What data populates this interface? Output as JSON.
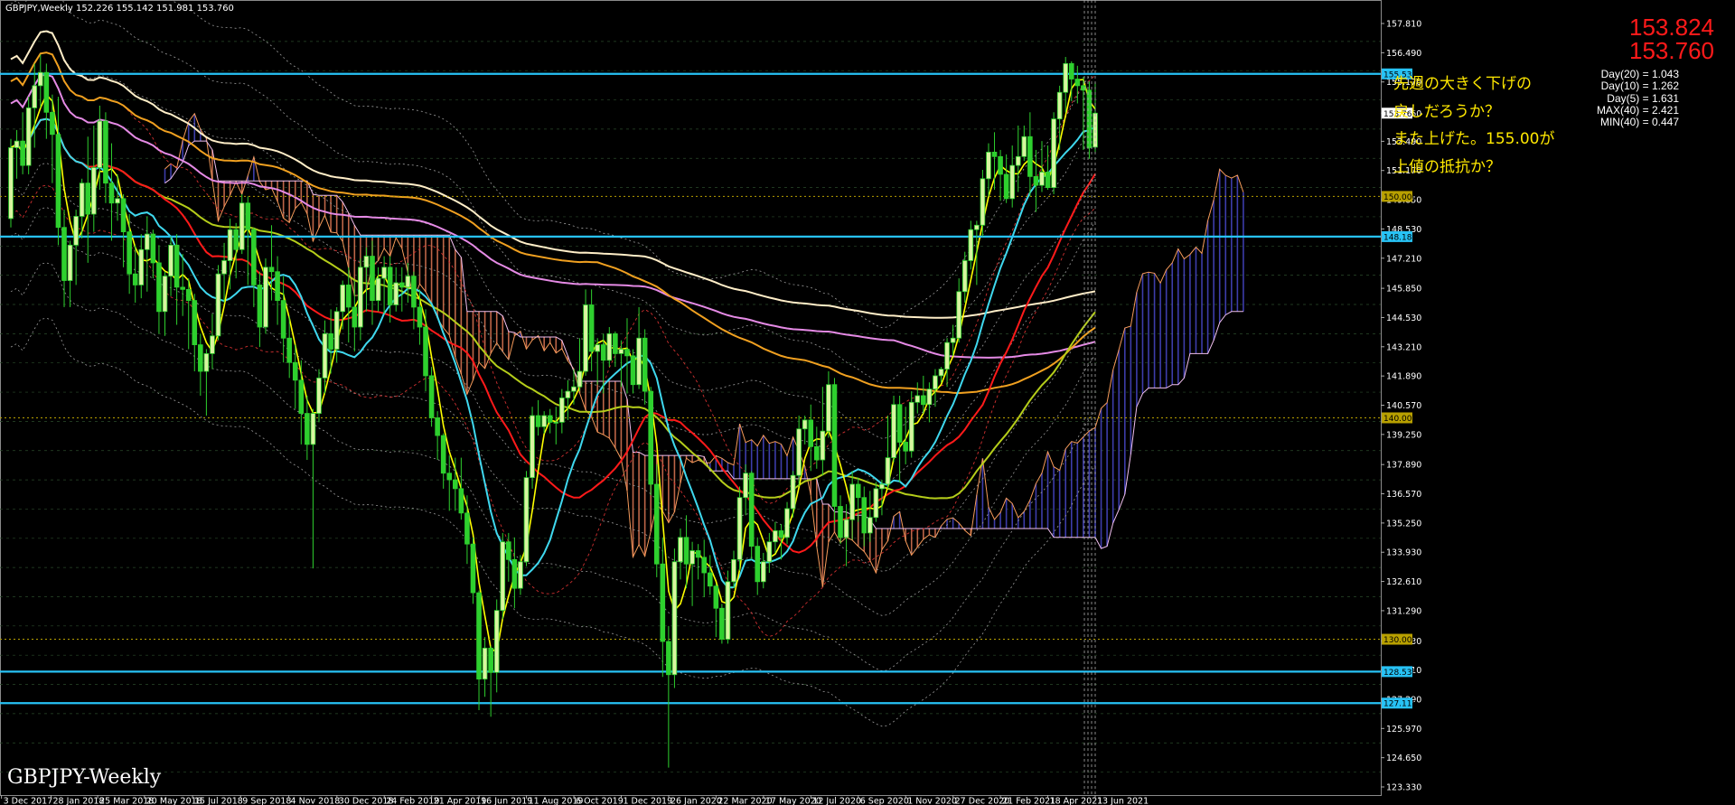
{
  "header": {
    "symbol": "GBPJPY,Weekly",
    "ohlc": "152.226 155.142 151.981 153.760"
  },
  "watermark": "GBPJPY-Weekly",
  "big_prices": {
    "bid": "153.824",
    "last": "153.760"
  },
  "stats": [
    "Day(20) = 1.043",
    "Day(10) = 1.262",
    "Day(5) = 1.631",
    "MAX(40) = 2.421",
    "MIN(40) = 0.447"
  ],
  "note_lines": [
    "先週の大きく下げの",
    "戻しだろうか？",
    "また上げた。155.00が",
    "上値の抵抗か？"
  ],
  "colors": {
    "background": "#000000",
    "bull": "#d8f5a0",
    "bear": "#2ed02e",
    "hline": "#27c2f5",
    "price_tag": "#27c2f5",
    "level_tag": "#b8a000",
    "ma_fast": "#ffff00",
    "ma_cyan": "#3fd8ee",
    "ma_red": "#ff1a1a",
    "ma_olive": "#b5cd1a",
    "ma_orange": "#f0a020",
    "ma_pink": "#e58ae5",
    "ma_cream": "#ffeec8",
    "cloud_up": "#4848c8",
    "cloud_down": "#e07855"
  },
  "chart_data": {
    "type": "candlestick",
    "title": "GBPJPY,Weekly",
    "ylim": [
      123.33,
      158.3
    ],
    "y_ticks": [
      "157.810",
      "156.490",
      "155.170",
      "153.760",
      "152.490",
      "151.170",
      "149.850",
      "148.530",
      "147.210",
      "145.850",
      "144.530",
      "143.210",
      "141.890",
      "140.570",
      "139.250",
      "137.890",
      "136.570",
      "135.250",
      "133.930",
      "132.610",
      "131.290",
      "129.930",
      "128.610",
      "127.290",
      "125.970",
      "124.650",
      "123.330"
    ],
    "x_ticks": [
      "3 Dec 2017",
      "28 Jan 2018",
      "25 Mar 2018",
      "20 May 2018",
      "15 Jul 2018",
      "9 Sep 2018",
      "4 Nov 2018",
      "30 Dec 2018",
      "24 Feb 2019",
      "21 Apr 2019",
      "16 Jun 2019",
      "11 Aug 2019",
      "6 Oct 2019",
      "1 Dec 2019",
      "26 Jan 2020",
      "22 Mar 2020",
      "17 May 2020",
      "12 Jul 2020",
      "6 Sep 2020",
      "1 Nov 2020",
      "27 Dec 2020",
      "21 Feb 2021",
      "18 Apr 2021",
      "13 Jun 2021"
    ],
    "horizontal_lines": [
      {
        "value": 155.535,
        "label": "155.535",
        "style": "cyan"
      },
      {
        "value": 148.184,
        "label": "148.184",
        "style": "cyan"
      },
      {
        "value": 128.538,
        "label": "128.538",
        "style": "cyan"
      },
      {
        "value": 127.115,
        "label": "127.115",
        "style": "cyan"
      }
    ],
    "level_lines": [
      {
        "value": 150.0,
        "label": "150.000"
      },
      {
        "value": 140.0,
        "label": "140.000"
      },
      {
        "value": 130.0,
        "label": "130.000"
      }
    ],
    "current_price": {
      "value": 153.76,
      "label": "153.760"
    },
    "candles": [
      [
        149.0,
        152.2,
        148.6,
        152.6
      ],
      [
        152.2,
        152.5,
        150.8,
        153.0
      ],
      [
        152.5,
        151.4,
        151.0,
        153.8
      ],
      [
        151.4,
        154.0,
        151.0,
        154.5
      ],
      [
        154.0,
        155.0,
        152.2,
        156.0
      ],
      [
        155.0,
        155.6,
        154.0,
        156.4
      ],
      [
        155.6,
        153.8,
        152.6,
        156.0
      ],
      [
        153.8,
        152.8,
        150.6,
        154.6
      ],
      [
        152.8,
        148.6,
        147.8,
        154.5
      ],
      [
        148.6,
        146.2,
        145.0,
        149.4
      ],
      [
        146.2,
        147.8,
        145.0,
        148.0
      ],
      [
        147.8,
        149.1,
        146.0,
        149.4
      ],
      [
        149.1,
        150.6,
        148.1,
        150.8
      ],
      [
        150.6,
        149.2,
        147.0,
        152.7
      ],
      [
        149.2,
        151.3,
        148.4,
        153.2
      ],
      [
        151.3,
        153.4,
        150.3,
        154.1
      ],
      [
        153.4,
        150.6,
        149.7,
        153.8
      ],
      [
        150.6,
        149.7,
        148.0,
        152.4
      ],
      [
        149.7,
        149.9,
        148.9,
        151.0
      ],
      [
        149.9,
        148.4,
        146.8,
        150.1
      ],
      [
        148.4,
        146.5,
        145.6,
        149.2
      ],
      [
        146.5,
        146.0,
        145.2,
        147.8
      ],
      [
        146.0,
        147.6,
        145.4,
        148.3
      ],
      [
        147.6,
        148.3,
        145.7,
        149.1
      ],
      [
        148.3,
        147.0,
        146.3,
        148.5
      ],
      [
        147.0,
        144.8,
        143.8,
        147.8
      ],
      [
        144.8,
        146.4,
        143.7,
        146.6
      ],
      [
        146.4,
        147.8,
        145.5,
        148.2
      ],
      [
        147.8,
        145.9,
        144.2,
        148.3
      ],
      [
        145.9,
        145.8,
        144.6,
        147.4
      ],
      [
        145.8,
        145.3,
        143.1,
        146.3
      ],
      [
        145.3,
        143.3,
        142.1,
        145.6
      ],
      [
        143.3,
        142.1,
        141.0,
        143.8
      ],
      [
        142.1,
        142.9,
        140.1,
        143.1
      ],
      [
        142.9,
        143.7,
        142.2,
        144.7
      ],
      [
        143.7,
        146.5,
        143.5,
        146.9
      ],
      [
        146.5,
        147.1,
        145.2,
        147.9
      ],
      [
        147.1,
        148.5,
        145.8,
        149.0
      ],
      [
        148.5,
        147.6,
        146.3,
        148.8
      ],
      [
        147.6,
        149.7,
        147.4,
        150.1
      ],
      [
        149.7,
        148.5,
        146.0,
        150.0
      ],
      [
        148.5,
        146.0,
        145.0,
        148.6
      ],
      [
        146.0,
        144.1,
        143.2,
        146.6
      ],
      [
        144.1,
        146.8,
        143.8,
        147.2
      ],
      [
        146.8,
        146.6,
        145.3,
        148.7
      ],
      [
        146.6,
        145.3,
        144.2,
        147.3
      ],
      [
        145.3,
        143.6,
        142.5,
        146.4
      ],
      [
        143.6,
        142.5,
        141.8,
        144.6
      ],
      [
        142.5,
        141.7,
        140.4,
        143.3
      ],
      [
        141.7,
        140.2,
        138.8,
        142.6
      ],
      [
        140.2,
        138.8,
        138.1,
        141.0
      ],
      [
        138.8,
        140.2,
        133.2,
        140.4
      ],
      [
        140.2,
        141.8,
        139.8,
        142.2
      ],
      [
        141.8,
        143.8,
        141.1,
        144.4
      ],
      [
        143.8,
        143.1,
        142.0,
        144.9
      ],
      [
        143.1,
        144.8,
        142.5,
        145.0
      ],
      [
        144.8,
        146.0,
        144.0,
        146.2
      ],
      [
        146.0,
        145.0,
        143.4,
        146.8
      ],
      [
        145.0,
        144.1,
        143.0,
        146.2
      ],
      [
        144.1,
        146.8,
        143.5,
        147.2
      ],
      [
        146.8,
        147.3,
        144.8,
        147.7
      ],
      [
        147.3,
        145.3,
        144.2,
        148.0
      ],
      [
        145.3,
        146.3,
        144.8,
        146.8
      ],
      [
        146.3,
        146.8,
        144.7,
        147.3
      ],
      [
        146.8,
        145.1,
        144.3,
        147.3
      ],
      [
        145.1,
        146.1,
        144.8,
        146.8
      ],
      [
        146.1,
        145.9,
        144.8,
        146.8
      ],
      [
        145.9,
        146.4,
        145.2,
        147.0
      ],
      [
        146.4,
        145.0,
        144.0,
        146.6
      ],
      [
        145.0,
        144.1,
        143.3,
        145.8
      ],
      [
        144.1,
        141.9,
        141.2,
        144.9
      ],
      [
        141.9,
        140.0,
        139.6,
        142.3
      ],
      [
        140.0,
        139.2,
        138.1,
        140.3
      ],
      [
        139.2,
        137.5,
        136.8,
        139.3
      ],
      [
        137.5,
        137.2,
        135.8,
        138.3
      ],
      [
        137.2,
        136.8,
        135.8,
        138.2
      ],
      [
        136.8,
        135.7,
        135.4,
        138.2
      ],
      [
        135.7,
        134.3,
        133.4,
        136.5
      ],
      [
        134.3,
        132.1,
        131.6,
        134.6
      ],
      [
        132.1,
        128.2,
        126.8,
        132.2
      ],
      [
        128.2,
        129.6,
        127.4,
        130.1
      ],
      [
        129.6,
        128.5,
        126.5,
        129.7
      ],
      [
        128.5,
        131.3,
        127.6,
        131.8
      ],
      [
        131.3,
        134.4,
        130.9,
        134.8
      ],
      [
        134.4,
        133.6,
        132.6,
        134.8
      ],
      [
        133.6,
        132.3,
        131.4,
        134.6
      ],
      [
        132.3,
        133.5,
        132.0,
        133.8
      ],
      [
        133.5,
        137.3,
        133.3,
        137.6
      ],
      [
        137.3,
        140.1,
        136.8,
        140.5
      ],
      [
        140.1,
        139.6,
        139.2,
        140.8
      ],
      [
        139.6,
        140.1,
        139.3,
        140.3
      ],
      [
        140.1,
        139.8,
        139.3,
        140.4
      ],
      [
        139.8,
        139.8,
        138.8,
        140.5
      ],
      [
        139.8,
        140.9,
        139.3,
        141.3
      ],
      [
        140.9,
        141.2,
        139.9,
        141.7
      ],
      [
        141.2,
        141.4,
        140.6,
        142.2
      ],
      [
        141.4,
        142.1,
        141.2,
        143.6
      ],
      [
        142.1,
        145.1,
        141.9,
        145.8
      ],
      [
        145.1,
        143.0,
        142.1,
        145.8
      ],
      [
        143.0,
        143.3,
        141.5,
        143.6
      ],
      [
        143.3,
        142.6,
        141.1,
        143.8
      ],
      [
        142.6,
        143.8,
        142.3,
        144.1
      ],
      [
        143.8,
        142.9,
        142.3,
        143.9
      ],
      [
        142.9,
        143.1,
        141.4,
        143.5
      ],
      [
        143.1,
        142.8,
        141.1,
        144.5
      ],
      [
        142.8,
        141.5,
        141.1,
        143.1
      ],
      [
        141.5,
        143.6,
        141.3,
        145.0
      ],
      [
        143.6,
        141.2,
        140.6,
        144.0
      ],
      [
        141.2,
        137.0,
        136.5,
        141.4
      ],
      [
        137.0,
        133.4,
        132.8,
        137.9
      ],
      [
        133.4,
        129.9,
        128.3,
        134.6
      ],
      [
        129.9,
        128.4,
        124.2,
        130.6
      ],
      [
        128.4,
        133.5,
        127.8,
        134.1
      ],
      [
        133.5,
        134.6,
        132.7,
        135.0
      ],
      [
        134.6,
        133.4,
        132.3,
        135.6
      ],
      [
        133.4,
        134.0,
        131.5,
        134.4
      ],
      [
        134.0,
        133.7,
        132.7,
        134.3
      ],
      [
        133.7,
        133.0,
        131.9,
        134.5
      ],
      [
        133.0,
        132.4,
        132.0,
        133.8
      ],
      [
        132.4,
        131.4,
        130.1,
        132.5
      ],
      [
        131.4,
        130.0,
        129.8,
        131.6
      ],
      [
        130.0,
        132.6,
        129.8,
        133.1
      ],
      [
        132.6,
        133.6,
        132.3,
        134.0
      ],
      [
        133.6,
        136.4,
        133.1,
        136.9
      ],
      [
        136.4,
        137.5,
        135.6,
        137.9
      ],
      [
        137.5,
        134.2,
        133.6,
        137.6
      ],
      [
        134.2,
        132.6,
        132.0,
        134.6
      ],
      [
        132.6,
        133.5,
        132.3,
        133.9
      ],
      [
        133.5,
        134.4,
        133.0,
        134.8
      ],
      [
        134.4,
        134.9,
        133.9,
        135.3
      ],
      [
        134.9,
        134.6,
        133.6,
        135.2
      ],
      [
        134.6,
        135.9,
        134.3,
        136.2
      ],
      [
        135.9,
        137.4,
        135.5,
        137.6
      ],
      [
        137.4,
        139.5,
        136.9,
        140.1
      ],
      [
        139.5,
        139.9,
        138.8,
        140.1
      ],
      [
        139.9,
        138.7,
        137.6,
        140.6
      ],
      [
        138.7,
        138.1,
        137.7,
        139.6
      ],
      [
        138.1,
        139.4,
        137.4,
        141.4
      ],
      [
        139.4,
        141.5,
        139.1,
        142.1
      ],
      [
        141.5,
        136.0,
        135.2,
        141.8
      ],
      [
        136.0,
        134.6,
        134.3,
        136.5
      ],
      [
        134.6,
        135.4,
        133.3,
        136.1
      ],
      [
        135.4,
        137.0,
        134.5,
        137.6
      ],
      [
        137.0,
        136.4,
        135.3,
        137.3
      ],
      [
        136.4,
        134.8,
        134.2,
        136.9
      ],
      [
        134.8,
        135.5,
        134.4,
        136.7
      ],
      [
        135.5,
        136.8,
        135.3,
        137.1
      ],
      [
        136.8,
        137.0,
        135.6,
        137.2
      ],
      [
        137.0,
        138.2,
        136.8,
        140.1
      ],
      [
        138.2,
        140.6,
        138.0,
        141.0
      ],
      [
        140.6,
        138.9,
        137.1,
        141.0
      ],
      [
        138.9,
        138.5,
        137.9,
        140.5
      ],
      [
        138.5,
        140.7,
        138.2,
        141.2
      ],
      [
        140.7,
        141.0,
        140.2,
        141.6
      ],
      [
        141.0,
        140.6,
        140.2,
        141.9
      ],
      [
        140.6,
        141.3,
        139.8,
        141.6
      ],
      [
        141.3,
        141.9,
        140.5,
        142.2
      ],
      [
        141.9,
        142.2,
        141.6,
        142.3
      ],
      [
        142.2,
        143.4,
        141.4,
        143.6
      ],
      [
        143.4,
        143.6,
        142.8,
        144.2
      ],
      [
        143.6,
        145.7,
        143.4,
        146.3
      ],
      [
        145.7,
        147.1,
        145.2,
        147.5
      ],
      [
        147.1,
        148.5,
        146.7,
        148.9
      ],
      [
        148.5,
        148.7,
        146.0,
        148.9
      ],
      [
        148.7,
        150.8,
        148.2,
        151.2
      ],
      [
        150.8,
        152.0,
        150.0,
        152.4
      ],
      [
        152.0,
        151.8,
        150.3,
        152.9
      ],
      [
        151.8,
        151.0,
        149.8,
        152.1
      ],
      [
        151.0,
        149.9,
        149.7,
        151.9
      ],
      [
        149.9,
        151.4,
        149.5,
        152.3
      ],
      [
        151.4,
        151.8,
        150.2,
        153.2
      ],
      [
        151.8,
        152.7,
        151.6,
        153.2
      ],
      [
        152.7,
        150.9,
        150.0,
        153.8
      ],
      [
        150.9,
        150.5,
        149.3,
        152.1
      ],
      [
        150.5,
        151.1,
        150.2,
        152.5
      ],
      [
        151.1,
        150.4,
        150.3,
        152.3
      ],
      [
        150.4,
        153.5,
        150.1,
        153.8
      ],
      [
        153.5,
        154.7,
        152.1,
        155.0
      ],
      [
        154.7,
        156.0,
        153.8,
        156.3
      ],
      [
        156.0,
        155.3,
        154.3,
        156.1
      ],
      [
        155.3,
        155.0,
        154.2,
        155.9
      ],
      [
        155.0,
        154.8,
        152.1,
        155.4
      ],
      [
        154.8,
        152.2,
        151.7,
        155.2
      ],
      [
        152.226,
        153.76,
        151.981,
        155.142
      ]
    ]
  }
}
